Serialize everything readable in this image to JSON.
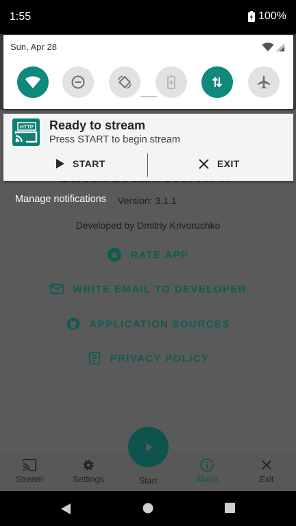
{
  "status_bar": {
    "time": "1:55",
    "battery": "100%",
    "battery_icon": "battery-charging-icon"
  },
  "quick_settings": {
    "date": "Sun, Apr 28",
    "status_icons": [
      "wifi-signal-icon",
      "cellular-signal-icon"
    ],
    "tiles": [
      {
        "name": "wifi-icon",
        "state": "on"
      },
      {
        "name": "do-not-disturb-icon",
        "state": "off"
      },
      {
        "name": "auto-rotate-icon",
        "state": "off"
      },
      {
        "name": "battery-saver-icon",
        "state": "off"
      },
      {
        "name": "mobile-data-icon",
        "state": "on"
      },
      {
        "name": "airplane-mode-icon",
        "state": "off"
      }
    ]
  },
  "notification": {
    "app_icon": "http-cast-icon",
    "title": "Ready to stream",
    "text": "Press START to begin stream",
    "actions": {
      "start": "START",
      "exit": "EXIT"
    }
  },
  "manage_notifications": "Manage notifications",
  "app": {
    "title": "Screen Stream over HTTP",
    "version": "Version: 3.1.1",
    "developer": "Developed by Dmitriy Krivoruchko",
    "links": {
      "rate": "RATE APP",
      "email": "WRITE EMAIL TO DEVELOPER",
      "sources": "APPLICATION SOURCES",
      "privacy": "PRIVACY POLICY"
    },
    "bottom_nav": {
      "stream": "Stream",
      "settings": "Settings",
      "start": "Start",
      "about": "About",
      "exit": "Exit"
    }
  },
  "colors": {
    "accent": "#0e8a7b",
    "dim_accent": "#0f544c",
    "panel": "#ffffff"
  }
}
